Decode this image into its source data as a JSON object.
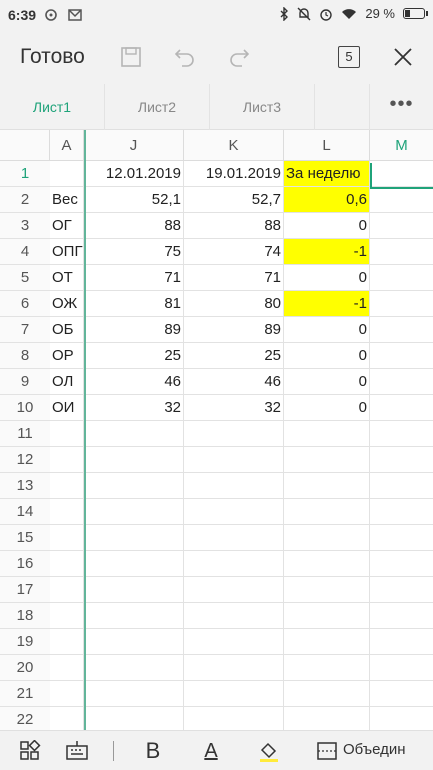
{
  "status_bar": {
    "time": "6:39",
    "battery": "29 %",
    "battery_level": 0.29
  },
  "toolbar": {
    "done_label": "Готово",
    "sheets_count": "5"
  },
  "tabs": [
    {
      "label": "Лист1",
      "active": true
    },
    {
      "label": "Лист2",
      "active": false
    },
    {
      "label": "Лист3",
      "active": false
    }
  ],
  "grid": {
    "columns": [
      "A",
      "J",
      "K",
      "L",
      "M"
    ],
    "rows": [
      {
        "num": "1",
        "a": "",
        "j": "12.01.2019",
        "k": "19.01.2019",
        "l": "За неделю"
      },
      {
        "num": "2",
        "a": "Вес",
        "j": "52,1",
        "k": "52,7",
        "l": "0,6"
      },
      {
        "num": "3",
        "a": "ОГ",
        "j": "88",
        "k": "88",
        "l": "0"
      },
      {
        "num": "4",
        "a": "ОПГ",
        "j": "75",
        "k": "74",
        "l": "-1"
      },
      {
        "num": "5",
        "a": "ОТ",
        "j": "71",
        "k": "71",
        "l": "0"
      },
      {
        "num": "6",
        "a": "ОЖ",
        "j": "81",
        "k": "80",
        "l": "-1"
      },
      {
        "num": "7",
        "a": "ОБ",
        "j": "89",
        "k": "89",
        "l": "0"
      },
      {
        "num": "8",
        "a": "ОР",
        "j": "25",
        "k": "25",
        "l": "0"
      },
      {
        "num": "9",
        "a": "ОЛ",
        "j": "46",
        "k": "46",
        "l": "0"
      },
      {
        "num": "10",
        "a": "ОИ",
        "j": "32",
        "k": "32",
        "l": "0"
      },
      {
        "num": "11"
      },
      {
        "num": "12"
      },
      {
        "num": "13"
      },
      {
        "num": "14"
      },
      {
        "num": "15"
      },
      {
        "num": "16"
      },
      {
        "num": "17"
      },
      {
        "num": "18"
      },
      {
        "num": "19"
      },
      {
        "num": "20"
      },
      {
        "num": "21"
      },
      {
        "num": "22"
      }
    ],
    "highlighted_l_rows": [
      "1",
      "2",
      "4",
      "6"
    ],
    "highlight_color": "#ffff00",
    "accent_color": "#1fa37a"
  },
  "bottom_bar": {
    "icons": [
      "grid-apps-icon",
      "keyboard-icon",
      "bold-icon",
      "font-color-icon",
      "fill-color-icon",
      "merge-cells-icon"
    ],
    "bold_label": "B",
    "font_color_label": "A",
    "merge_label": "Объедин"
  }
}
